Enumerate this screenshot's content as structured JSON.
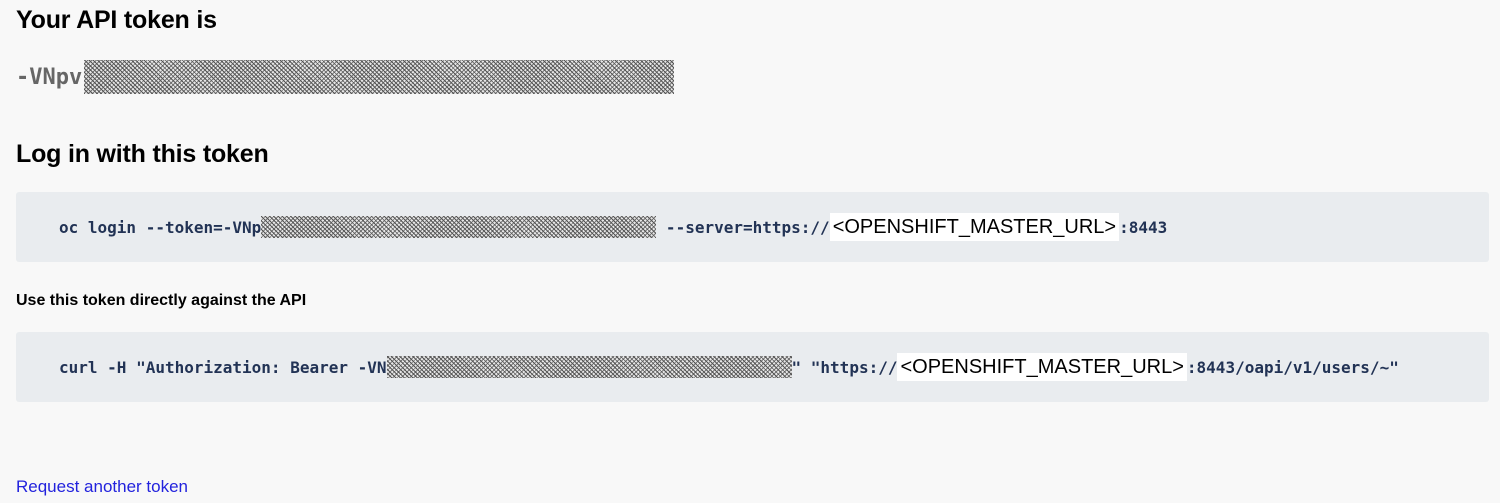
{
  "token_section": {
    "heading": "Your API token is",
    "token_visible_prefix": "-VNpv"
  },
  "login_section": {
    "heading": "Log in with this token",
    "command_prefix": "oc login --token=-VNp",
    "command_server": " --server=https://",
    "command_url_placeholder": "<OPENSHIFT_MASTER_URL>",
    "command_suffix": ":8443"
  },
  "api_section": {
    "label": "Use this token directly against the API",
    "command_prefix": "curl -H \"Authorization: Bearer -VN",
    "command_mid": "\" \"https://",
    "command_url_placeholder": "<OPENSHIFT_MASTER_URL>",
    "command_suffix": ":8443/oapi/v1/users/~\""
  },
  "footer": {
    "request_link": "Request another token"
  }
}
